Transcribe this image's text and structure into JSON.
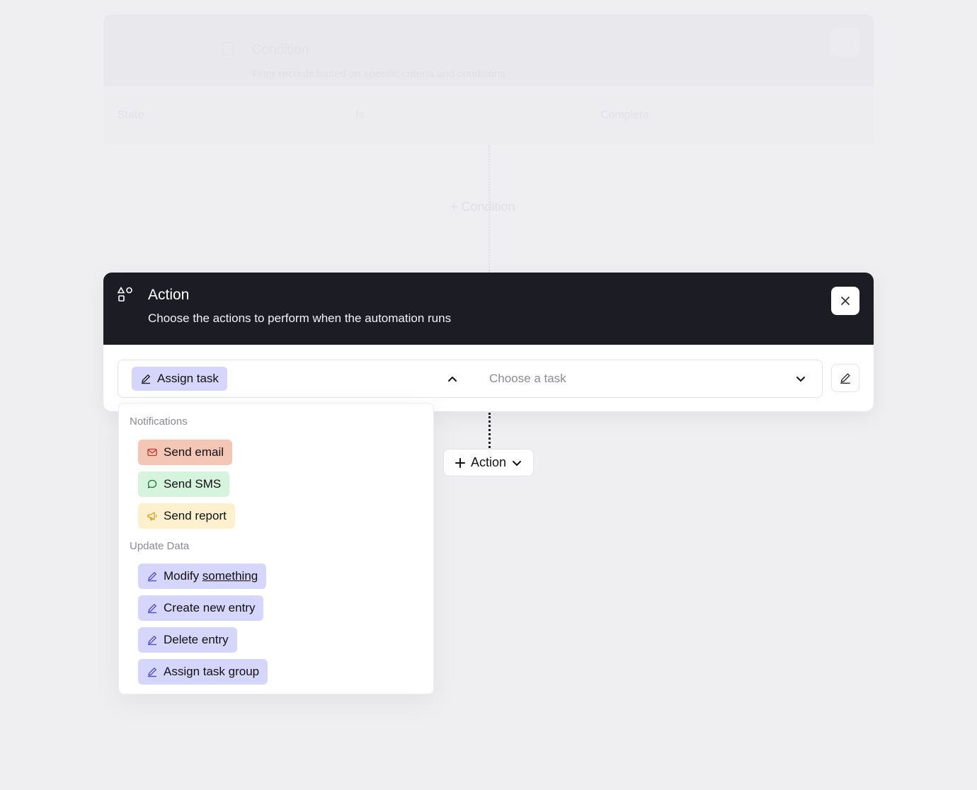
{
  "background": {
    "condition_title": "Condition",
    "condition_subtitle": "Filter records based on specific criteria and conditions",
    "row_field": "State",
    "row_operator": "Is",
    "row_value": "Complete",
    "add_condition_label": "+ Condition"
  },
  "action": {
    "title": "Action",
    "subtitle": "Choose the actions to perform when the automation runs",
    "selected_chip": "Assign task",
    "task_placeholder": "Choose a task"
  },
  "add_action": {
    "label": "Action"
  },
  "dropdown": {
    "groups": [
      {
        "label": "Notifications",
        "items": [
          {
            "label": "Send email",
            "icon": "mail-icon",
            "color": "#f3c6b5"
          },
          {
            "label": "Send SMS",
            "icon": "chat-bubble-icon",
            "color": "#d6f3dd"
          },
          {
            "label": "Send report",
            "icon": "megaphone-icon",
            "color": "#fdf0cf"
          }
        ]
      },
      {
        "label": "Update Data",
        "items": [
          {
            "label_prefix": "Modify ",
            "label_underlined": "something",
            "icon": "pencil-icon",
            "color": "#d6d5fb"
          },
          {
            "label": "Create new entry",
            "icon": "pencil-icon",
            "color": "#d6d5fb"
          },
          {
            "label": "Delete entry",
            "icon": "pencil-icon",
            "color": "#d6d5fb"
          },
          {
            "label": "Assign task group",
            "icon": "pencil-icon",
            "color": "#d6d5fb"
          }
        ]
      }
    ]
  },
  "colors": {
    "header_bg": "#1c1d24",
    "page_bg": "#efeff1",
    "assign_chip": "#d6d5fb"
  }
}
